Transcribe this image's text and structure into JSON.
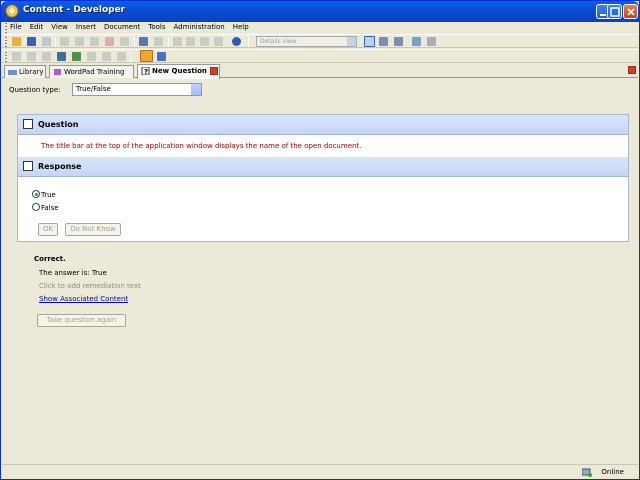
{
  "window": {
    "title": "Content - Developer"
  },
  "menu": [
    "File",
    "Edit",
    "View",
    "Insert",
    "Document",
    "Tools",
    "Administration",
    "Help"
  ],
  "toolbar": {
    "view_select": "Details view"
  },
  "tabs": [
    {
      "label": "Library"
    },
    {
      "label": "WordPad Training"
    },
    {
      "label": "New Question"
    }
  ],
  "question_type": {
    "label": "Question type:",
    "value": "True/False"
  },
  "question": {
    "heading": "Question",
    "text": "The title bar at the top of the application window displays the name of the open document."
  },
  "response": {
    "heading": "Response",
    "options": [
      {
        "label": "True",
        "selected": true
      },
      {
        "label": "False",
        "selected": false
      }
    ],
    "ok_label": "OK",
    "dont_know_label": "Do Not Know"
  },
  "feedback": {
    "status": "Correct.",
    "answer": "The answer is: True",
    "remediation": "Click to add remediation text",
    "show_link": "Show Associated Content",
    "retake_label": "Take question again"
  },
  "status": {
    "text": "Online"
  },
  "colors": {
    "title_bar": "#0b4ed6",
    "question_text": "#b00000",
    "link": "#0000cc",
    "panel_header": "#c5d6f4"
  }
}
